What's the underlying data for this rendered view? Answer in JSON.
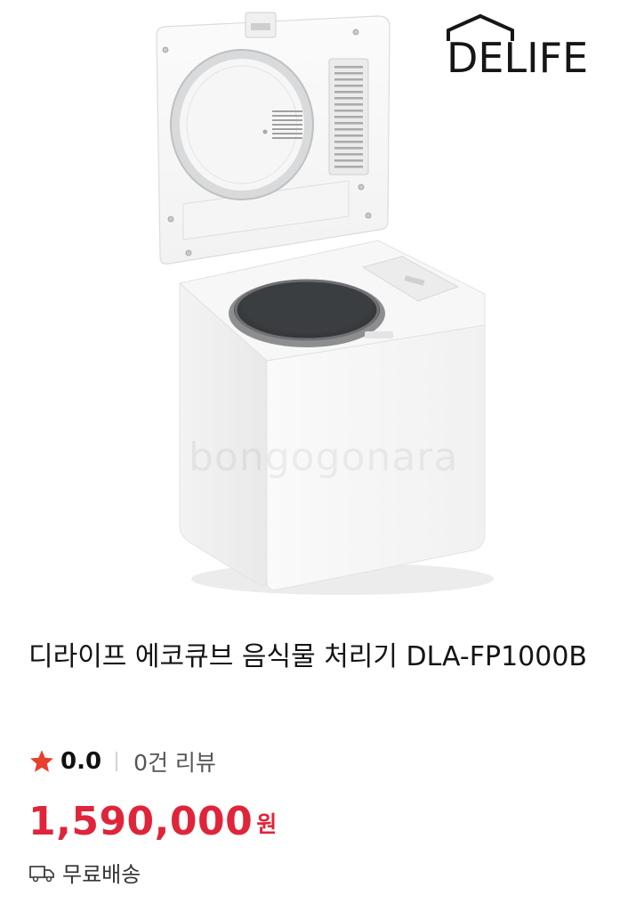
{
  "brand": {
    "logo_text": "DELIFE"
  },
  "hero": {
    "watermark_text": "bongogonara"
  },
  "product": {
    "title": "디라이프 에코큐브 음식물 처리기 DLA-FP1000B",
    "rating": "0.0",
    "review_count": "0건 리뷰",
    "price": "1,590,000",
    "currency": "원",
    "shipping": "무료배송"
  },
  "colors": {
    "price": "#e0243a",
    "star": "#e8402c",
    "text": "#141414"
  },
  "icons": {
    "rating": "star-icon",
    "shipping": "truck-icon"
  }
}
